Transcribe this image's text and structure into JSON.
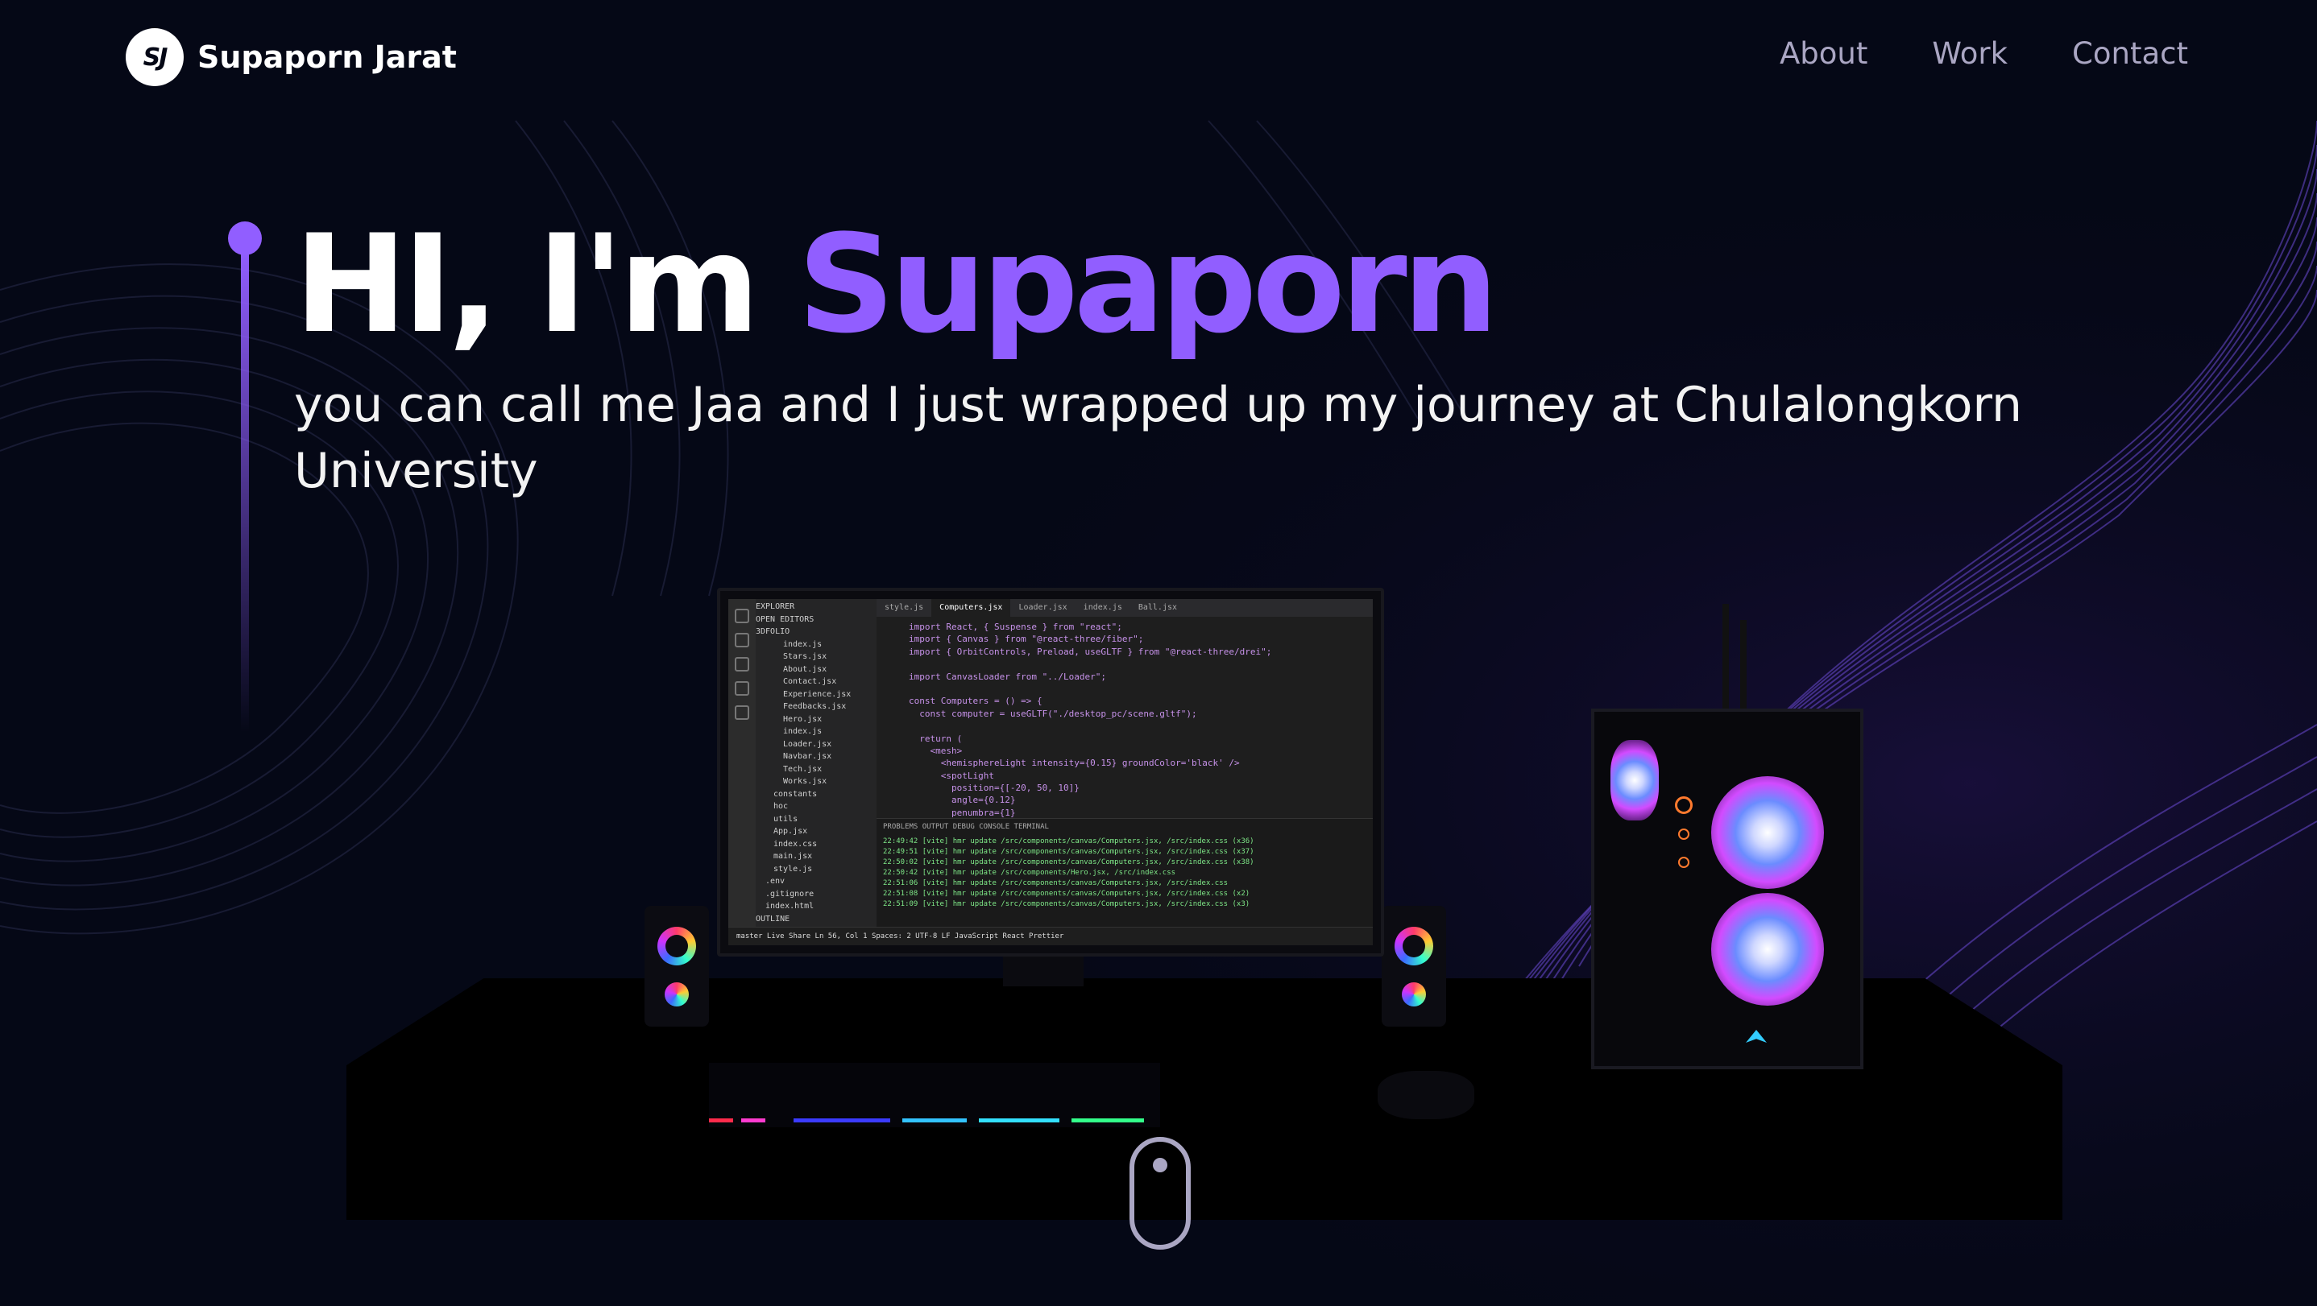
{
  "nav": {
    "logo_initials": "SJ",
    "logo_name": "Supaporn Jarat",
    "links": [
      "About",
      "Work",
      "Contact"
    ]
  },
  "hero": {
    "title_prefix": "HI, I'm ",
    "title_name": "Supaporn",
    "subtitle": "you can call me Jaa and I just wrapped up my journey at Chulalongkorn University"
  },
  "colors": {
    "background": "#050816",
    "accent": "#915eff",
    "nav_text": "#aaa6c3"
  },
  "scene": {
    "tabs": [
      "style.js",
      "Computers.jsx",
      "Loader.jsx",
      "index.js",
      "Ball.jsx"
    ],
    "explorer": [
      "EXPLORER",
      "OPEN EDITORS",
      "3DFOLIO",
      "index.js",
      "Stars.jsx",
      "About.jsx",
      "Contact.jsx",
      "Experience.jsx",
      "Feedbacks.jsx",
      "Hero.jsx",
      "index.js",
      "Loader.jsx",
      "Navbar.jsx",
      "Tech.jsx",
      "Works.jsx",
      "constants",
      "hoc",
      "utils",
      "App.jsx",
      "index.css",
      "main.jsx",
      "style.js",
      ".env",
      ".gitignore",
      "index.html",
      "OUTLINE"
    ],
    "code_lines": [
      "import React, { Suspense } from \"react\";",
      "import { Canvas } from \"@react-three/fiber\";",
      "import { OrbitControls, Preload, useGLTF } from \"@react-three/drei\";",
      "",
      "import CanvasLoader from \"../Loader\";",
      "",
      "const Computers = () => {",
      "  const computer = useGLTF(\"./desktop_pc/scene.gltf\");",
      "",
      "  return (",
      "    <mesh>",
      "      <hemisphereLight intensity={0.15} groundColor='black' />",
      "      <spotLight",
      "        position={[-20, 50, 10]}",
      "        angle={0.12}",
      "        penumbra={1}"
    ],
    "terminal_tabs": "PROBLEMS   OUTPUT   DEBUG CONSOLE   TERMINAL",
    "terminal_lines": [
      "22:49:42 [vite] hmr update /src/components/canvas/Computers.jsx, /src/index.css (x36)",
      "22:49:51 [vite] hmr update /src/components/canvas/Computers.jsx, /src/index.css (x37)",
      "22:50:02 [vite] hmr update /src/components/canvas/Computers.jsx, /src/index.css (x38)",
      "22:50:42 [vite] hmr update /src/components/Hero.jsx, /src/index.css",
      "22:51:06 [vite] hmr update /src/components/canvas/Computers.jsx, /src/index.css",
      "22:51:08 [vite] hmr update /src/components/canvas/Computers.jsx, /src/index.css (x2)",
      "22:51:09 [vite] hmr update /src/components/canvas/Computers.jsx, /src/index.css (x3)"
    ],
    "status_bar": "master   Live Share        Ln 56, Col 1   Spaces: 2   UTF-8   LF   JavaScript React   Prettier"
  }
}
